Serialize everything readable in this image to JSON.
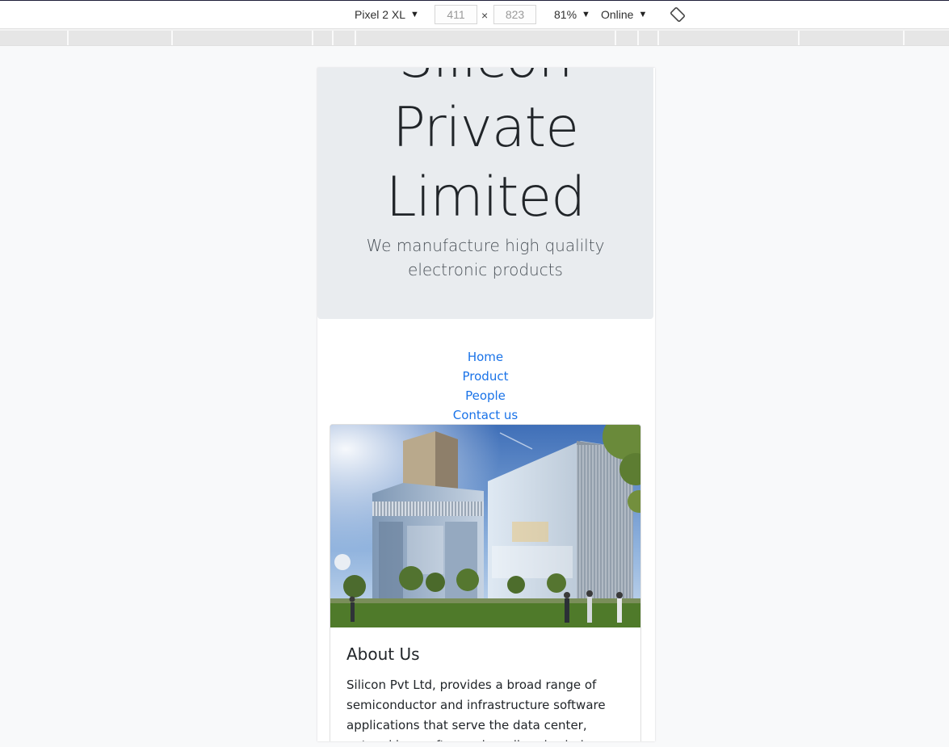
{
  "devtools": {
    "device": "Pixel 2 XL",
    "width": "411",
    "height": "823",
    "zoom": "81%",
    "throttle": "Online",
    "dims_separator": "×",
    "caret": "▼"
  },
  "jumbotron": {
    "title": "Silicon Private Limited",
    "lead": "We manufacture high qualilty electronic products"
  },
  "nav": {
    "items": [
      {
        "label": "Home"
      },
      {
        "label": "Product"
      },
      {
        "label": "People"
      },
      {
        "label": "Contact us"
      }
    ]
  },
  "card": {
    "title": "About Us",
    "text": "Silicon Pvt Ltd, provides a broad range of semiconductor and infrastructure software applications that serve the data center, networking, software, broadband, wireless, and"
  },
  "colors": {
    "link": "#1a73e8",
    "jumbotron_bg": "#e9ecef",
    "page_bg": "#f8f9fa"
  }
}
